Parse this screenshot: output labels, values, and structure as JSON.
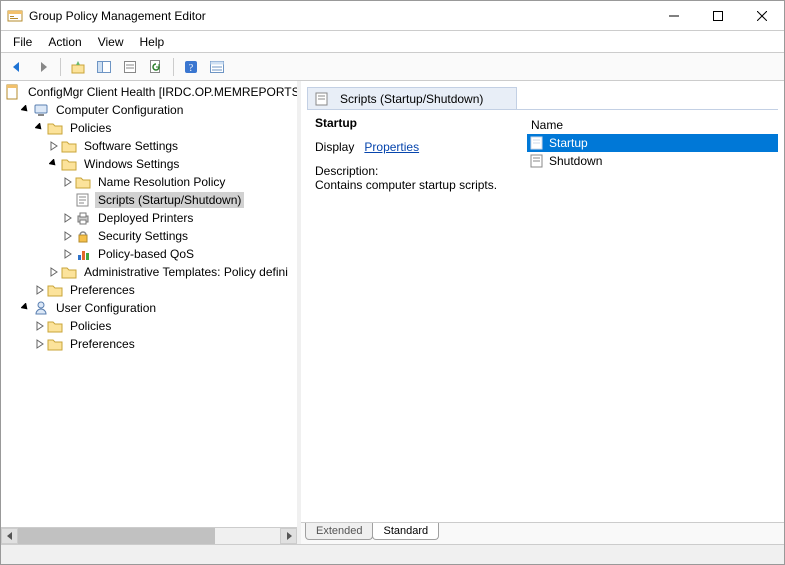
{
  "window": {
    "title": "Group Policy Management Editor"
  },
  "menu": {
    "file": "File",
    "action": "Action",
    "view": "View",
    "help": "Help"
  },
  "tree": {
    "root": "ConfigMgr Client Health [IRDC.OP.MEMREPORTS.",
    "computer_config": "Computer Configuration",
    "policies": "Policies",
    "software_settings": "Software Settings",
    "windows_settings": "Windows Settings",
    "name_resolution": "Name Resolution Policy",
    "scripts": "Scripts (Startup/Shutdown)",
    "deployed_printers": "Deployed Printers",
    "security_settings": "Security Settings",
    "policy_qos": "Policy-based QoS",
    "admin_templates": "Administrative Templates: Policy defini",
    "preferences": "Preferences",
    "user_config": "User Configuration",
    "user_policies": "Policies",
    "user_preferences": "Preferences"
  },
  "right": {
    "header": "Scripts (Startup/Shutdown)",
    "detail_title": "Startup",
    "display_label": "Display",
    "properties_link": "Properties",
    "description_label": "Description:",
    "description_text": "Contains computer startup scripts.",
    "col_name": "Name",
    "item_startup": "Startup",
    "item_shutdown": "Shutdown"
  },
  "tabs": {
    "extended": "Extended",
    "standard": "Standard"
  }
}
